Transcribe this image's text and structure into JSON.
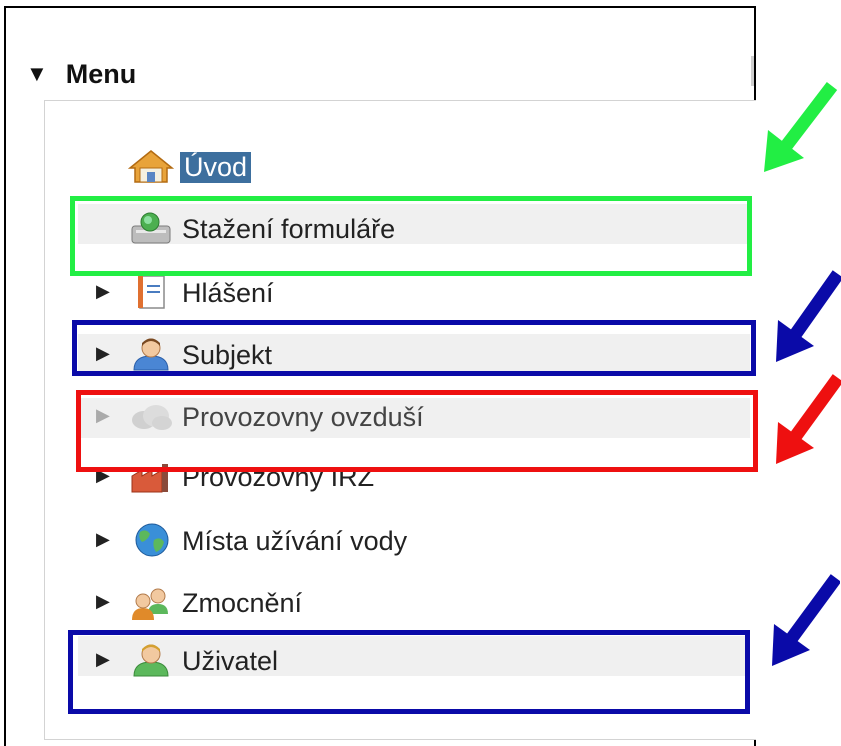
{
  "menu": {
    "title": "Menu",
    "toggle_icon": "triangle-down-icon",
    "items": [
      {
        "label": "Úvod",
        "icon": "home-icon",
        "expander": false,
        "selected": true
      },
      {
        "label": "Stažení formuláře",
        "icon": "download-form-icon",
        "expander": false,
        "selected": false
      },
      {
        "label": "Hlášení",
        "icon": "notebook-icon",
        "expander": true,
        "selected": false
      },
      {
        "label": "Subjekt",
        "icon": "person-icon",
        "expander": true,
        "selected": false
      },
      {
        "label": "Provozovny ovzduší",
        "icon": "cloud-icon",
        "expander": true,
        "selected": false
      },
      {
        "label": "Provozovny IRZ",
        "icon": "factory-icon",
        "expander": true,
        "selected": false
      },
      {
        "label": "Místa užívání vody",
        "icon": "globe-icon",
        "expander": true,
        "selected": false
      },
      {
        "label": "Zmocnění",
        "icon": "people-icon",
        "expander": true,
        "selected": false
      },
      {
        "label": "Uživatel",
        "icon": "user-icon",
        "expander": true,
        "selected": false
      }
    ]
  },
  "annotations": {
    "colors": {
      "green": "#22ee44",
      "blue": "#0a0aa8",
      "red": "#ee1010",
      "selected_bg": "#3d6f9e"
    }
  }
}
